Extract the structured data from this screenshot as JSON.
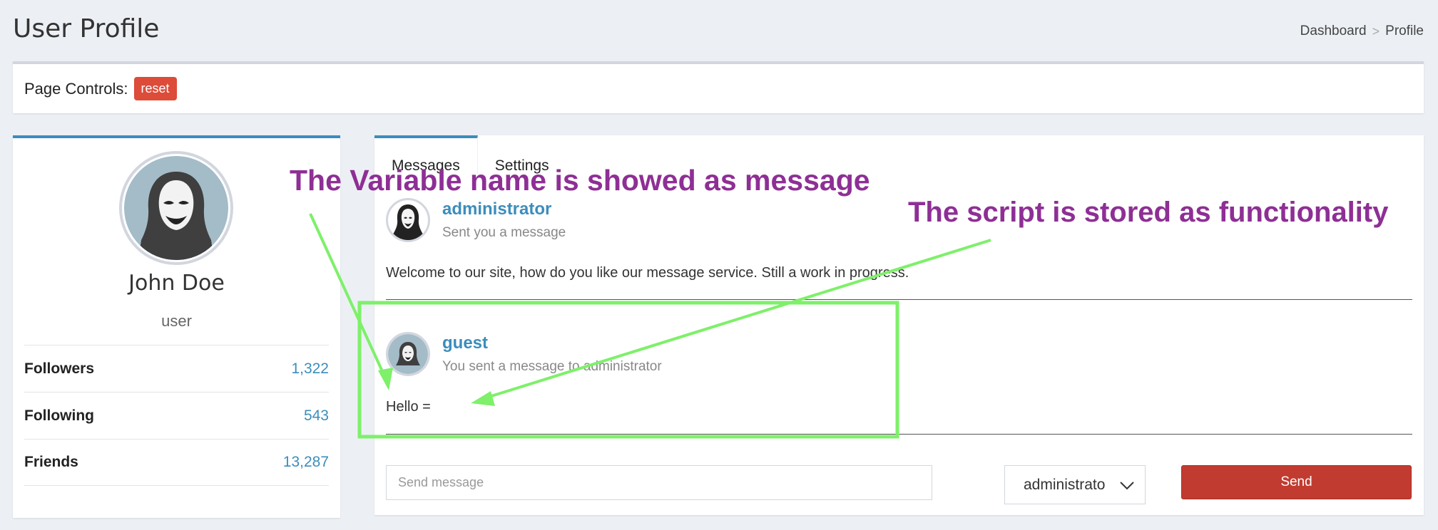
{
  "header": {
    "title": "User Profile",
    "breadcrumb": [
      "Dashboard",
      ">",
      "Profile"
    ]
  },
  "controls": {
    "label": "Page Controls:",
    "reset_label": "reset",
    "reset_color": "#dd4b39"
  },
  "profile": {
    "name": "John Doe",
    "role": "user",
    "stats": [
      {
        "label": "Followers",
        "value": "1,322"
      },
      {
        "label": "Following",
        "value": "543"
      },
      {
        "label": "Friends",
        "value": "13,287"
      }
    ]
  },
  "tabs": [
    {
      "label": "Messages",
      "active": true
    },
    {
      "label": "Settings",
      "active": false
    }
  ],
  "messages": [
    {
      "user": "administrator",
      "subtitle": "Sent you a message",
      "body": "Welcome to our site, how do you like our message service. Still a work in progress."
    },
    {
      "user": "guest",
      "subtitle": "You sent a message to administrator",
      "body": "Hello ="
    }
  ],
  "composer": {
    "placeholder": "Send message",
    "recipient": "administrato",
    "send_label": "Send",
    "send_color": "#c23b30"
  },
  "annotations": {
    "left": "The Variable name is showed as message",
    "right": "The script is stored as functionality",
    "text_color": "#8e2f95",
    "highlight_color": "#7ef06a"
  },
  "colors": {
    "accent": "#3c8dbc",
    "background": "#ecf0f5"
  }
}
